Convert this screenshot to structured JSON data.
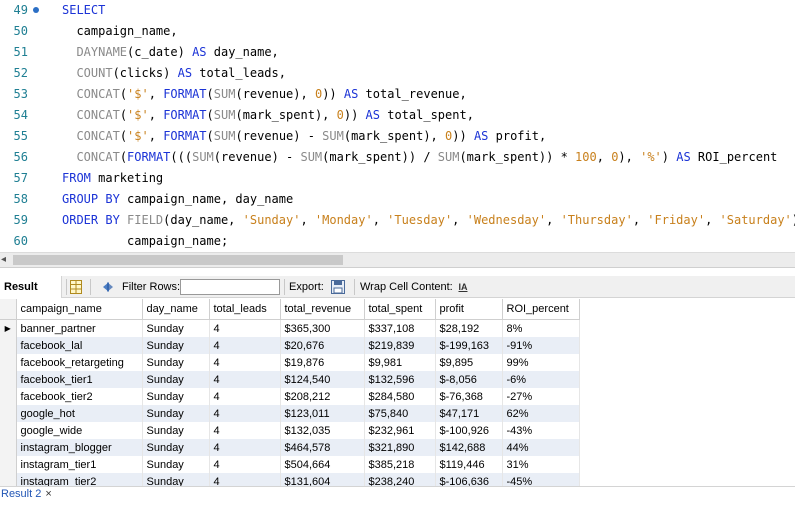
{
  "editor": {
    "lines": [
      {
        "num": "49",
        "marker": true,
        "tokens": [
          [
            "kw",
            "SELECT"
          ]
        ]
      },
      {
        "num": "50",
        "tokens": [
          [
            "id",
            "  campaign_name,"
          ]
        ]
      },
      {
        "num": "51",
        "tokens": [
          [
            "id",
            "  "
          ],
          [
            "fn",
            "DAYNAME"
          ],
          [
            "pu",
            "(c_date) "
          ],
          [
            "kw",
            "AS"
          ],
          [
            "id",
            " day_name,"
          ]
        ]
      },
      {
        "num": "52",
        "tokens": [
          [
            "id",
            "  "
          ],
          [
            "fn",
            "COUNT"
          ],
          [
            "pu",
            "(clicks) "
          ],
          [
            "kw",
            "AS"
          ],
          [
            "id",
            " total_leads,"
          ]
        ]
      },
      {
        "num": "53",
        "tokens": [
          [
            "id",
            "  "
          ],
          [
            "fn",
            "CONCAT"
          ],
          [
            "pu",
            "("
          ],
          [
            "str",
            "'$'"
          ],
          [
            "pu",
            ", "
          ],
          [
            "kw",
            "FORMAT"
          ],
          [
            "pu",
            "("
          ],
          [
            "fn",
            "SUM"
          ],
          [
            "pu",
            "(revenue), "
          ],
          [
            "num",
            "0"
          ],
          [
            "pu",
            ")) "
          ],
          [
            "kw",
            "AS"
          ],
          [
            "id",
            " total_revenue,"
          ]
        ]
      },
      {
        "num": "54",
        "tokens": [
          [
            "id",
            "  "
          ],
          [
            "fn",
            "CONCAT"
          ],
          [
            "pu",
            "("
          ],
          [
            "str",
            "'$'"
          ],
          [
            "pu",
            ", "
          ],
          [
            "kw",
            "FORMAT"
          ],
          [
            "pu",
            "("
          ],
          [
            "fn",
            "SUM"
          ],
          [
            "pu",
            "(mark_spent), "
          ],
          [
            "num",
            "0"
          ],
          [
            "pu",
            ")) "
          ],
          [
            "kw",
            "AS"
          ],
          [
            "id",
            " total_spent,"
          ]
        ]
      },
      {
        "num": "55",
        "tokens": [
          [
            "id",
            "  "
          ],
          [
            "fn",
            "CONCAT"
          ],
          [
            "pu",
            "("
          ],
          [
            "str",
            "'$'"
          ],
          [
            "pu",
            ", "
          ],
          [
            "kw",
            "FORMAT"
          ],
          [
            "pu",
            "("
          ],
          [
            "fn",
            "SUM"
          ],
          [
            "pu",
            "(revenue) - "
          ],
          [
            "fn",
            "SUM"
          ],
          [
            "pu",
            "(mark_spent), "
          ],
          [
            "num",
            "0"
          ],
          [
            "pu",
            ")) "
          ],
          [
            "kw",
            "AS"
          ],
          [
            "id",
            " profit,"
          ]
        ]
      },
      {
        "num": "56",
        "tokens": [
          [
            "id",
            "  "
          ],
          [
            "fn",
            "CONCAT"
          ],
          [
            "pu",
            "("
          ],
          [
            "kw",
            "FORMAT"
          ],
          [
            "pu",
            "((("
          ],
          [
            "fn",
            "SUM"
          ],
          [
            "pu",
            "(revenue) - "
          ],
          [
            "fn",
            "SUM"
          ],
          [
            "pu",
            "(mark_spent)) / "
          ],
          [
            "fn",
            "SUM"
          ],
          [
            "pu",
            "(mark_spent)) * "
          ],
          [
            "num",
            "100"
          ],
          [
            "pu",
            ", "
          ],
          [
            "num",
            "0"
          ],
          [
            "pu",
            "), "
          ],
          [
            "str",
            "'%'"
          ],
          [
            "pu",
            ") "
          ],
          [
            "kw",
            "AS"
          ],
          [
            "id",
            " ROI_percent"
          ]
        ]
      },
      {
        "num": "57",
        "tokens": [
          [
            "kw",
            "FROM"
          ],
          [
            "id",
            " marketing"
          ]
        ]
      },
      {
        "num": "58",
        "tokens": [
          [
            "kw",
            "GROUP BY"
          ],
          [
            "id",
            " campaign_name, day_name"
          ]
        ]
      },
      {
        "num": "59",
        "tokens": [
          [
            "kw",
            "ORDER BY"
          ],
          [
            "id",
            " "
          ],
          [
            "fn",
            "FIELD"
          ],
          [
            "pu",
            "(day_name, "
          ],
          [
            "str",
            "'Sunday'"
          ],
          [
            "pu",
            ", "
          ],
          [
            "str",
            "'Monday'"
          ],
          [
            "pu",
            ", "
          ],
          [
            "str",
            "'Tuesday'"
          ],
          [
            "pu",
            ", "
          ],
          [
            "str",
            "'Wednesday'"
          ],
          [
            "pu",
            ", "
          ],
          [
            "str",
            "'Thursday'"
          ],
          [
            "pu",
            ", "
          ],
          [
            "str",
            "'Friday'"
          ],
          [
            "pu",
            ", "
          ],
          [
            "str",
            "'Saturday'"
          ],
          [
            "pu",
            "),"
          ]
        ]
      },
      {
        "num": "60",
        "tokens": [
          [
            "id",
            "         campaign_name;"
          ]
        ]
      }
    ]
  },
  "toolbar": {
    "result_grid_label": "Result Grid",
    "filter_label": "Filter Rows:",
    "filter_value": "",
    "export_label": "Export:",
    "wrap_label": "Wrap Cell Content:",
    "wrap_icon_text": "IA"
  },
  "grid": {
    "columns": [
      "campaign_name",
      "day_name",
      "total_leads",
      "total_revenue",
      "total_spent",
      "profit",
      "ROI_percent"
    ],
    "rows": [
      [
        "banner_partner",
        "Sunday",
        "4",
        "$365,300",
        "$337,108",
        "$28,192",
        "8%"
      ],
      [
        "facebook_lal",
        "Sunday",
        "4",
        "$20,676",
        "$219,839",
        "$-199,163",
        "-91%"
      ],
      [
        "facebook_retargeting",
        "Sunday",
        "4",
        "$19,876",
        "$9,981",
        "$9,895",
        "99%"
      ],
      [
        "facebook_tier1",
        "Sunday",
        "4",
        "$124,540",
        "$132,596",
        "$-8,056",
        "-6%"
      ],
      [
        "facebook_tier2",
        "Sunday",
        "4",
        "$208,212",
        "$284,580",
        "$-76,368",
        "-27%"
      ],
      [
        "google_hot",
        "Sunday",
        "4",
        "$123,011",
        "$75,840",
        "$47,171",
        "62%"
      ],
      [
        "google_wide",
        "Sunday",
        "4",
        "$132,035",
        "$232,961",
        "$-100,926",
        "-43%"
      ],
      [
        "instagram_blogger",
        "Sunday",
        "4",
        "$464,578",
        "$321,890",
        "$142,688",
        "44%"
      ],
      [
        "instagram_tier1",
        "Sunday",
        "4",
        "$504,664",
        "$385,218",
        "$119,446",
        "31%"
      ],
      [
        "instagram_tier2",
        "Sunday",
        "4",
        "$131,604",
        "$238,240",
        "$-106,636",
        "-45%"
      ]
    ],
    "selected_row": 0
  },
  "result_tab": {
    "label": "Result 2",
    "close": "×"
  },
  "colors": {
    "keyword": "#1b33d6",
    "function": "#8a8a8a",
    "string": "#c8801c",
    "line_number": "#1f7f93",
    "row_alt": "#e9eef6",
    "tab_text": "#2256b5"
  }
}
